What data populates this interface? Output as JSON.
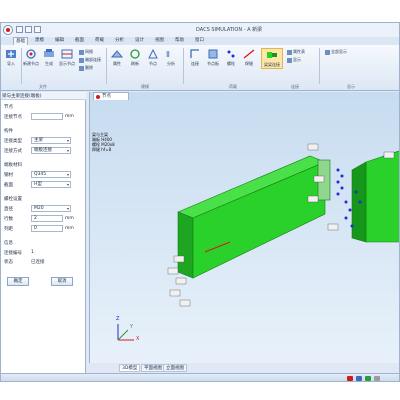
{
  "window": {
    "title": "DACS SIMULATION - A 新梁"
  },
  "tabs": [
    {
      "label": "基础",
      "active": true
    },
    {
      "label": "建模"
    },
    {
      "label": "编辑"
    },
    {
      "label": "截面"
    },
    {
      "label": "荷载"
    },
    {
      "label": "分析"
    },
    {
      "label": "设计"
    },
    {
      "label": "视图"
    },
    {
      "label": "帮助"
    },
    {
      "label": "窗口"
    }
  ],
  "ribbon": {
    "buttons": [
      {
        "label": "导入",
        "icon": "import-icon"
      },
      {
        "label": "新建节点",
        "icon": "node-icon"
      },
      {
        "label": "生成",
        "icon": "generate-icon"
      },
      {
        "label": "显示节点",
        "icon": "display-icon"
      },
      {
        "label": "网格",
        "icon": "grid-icon"
      },
      {
        "label": "端部连接",
        "icon": "end-connect-icon"
      },
      {
        "label": "删除",
        "icon": "delete-icon"
      },
      {
        "label": "属性",
        "icon": "properties-icon"
      },
      {
        "label": "刷新",
        "icon": "refresh-icon"
      },
      {
        "label": "节点",
        "icon": "node-icon-2"
      },
      {
        "label": "分析",
        "icon": "analyze-icon"
      },
      {
        "label": "连接",
        "icon": "connect-icon"
      },
      {
        "label": "节点板",
        "icon": "plate-icon"
      },
      {
        "label": "螺栓",
        "icon": "bolt-icon"
      },
      {
        "label": "焊缝",
        "icon": "weld-icon"
      },
      {
        "label": "梁梁连接",
        "icon": "beam-beam-icon"
      },
      {
        "label": "属性表",
        "icon": "table-icon"
      },
      {
        "label": "显示",
        "icon": "show-icon"
      },
      {
        "label": "全部显示",
        "icon": "show-all-icon"
      }
    ],
    "groups": [
      {
        "label": "文件"
      },
      {
        "label": "建模"
      },
      {
        "label": "荷载"
      },
      {
        "label": "连接"
      },
      {
        "label": "显示"
      }
    ]
  },
  "panel": {
    "title": "梁与主梁连接(端板)",
    "section_main": "节点",
    "label_node": "连接节点",
    "node_value": "",
    "node_unit": "mm",
    "section_type": "构件",
    "label_type1": "连接类型",
    "type1_value": "主梁",
    "label_type2": "连接方式",
    "type2_value": "端板连接",
    "section_material": "端板材料",
    "label_mat1": "钢材",
    "mat1_value": "Q345",
    "label_mat2": "截面",
    "mat2_value": "H型",
    "section_bolt": "螺栓设置",
    "label_bolt1": "直径",
    "bolt1_value": "M20",
    "label_bolt2": "行数",
    "bolt2_value": "2",
    "label_bolt3": "列距",
    "bolt3_value": "0",
    "bolt_unit": "mm",
    "section_info": "信息",
    "info_label1": "连接编号",
    "info_value1": "1",
    "info_label2": "状态",
    "info_value2": "已连接",
    "ok_label": "确定",
    "cancel_label": "取消"
  },
  "viewport": {
    "doc_tab": "节点",
    "annotation_lines": [
      "梁与主梁",
      "端板 H400",
      "螺栓 M20x8",
      "焊缝 hf=8"
    ],
    "axis_x": "X",
    "axis_y": "Y",
    "axis_z": "Z"
  },
  "view_tabs": [
    {
      "label": "3D模型",
      "active": true
    },
    {
      "label": "平面视图"
    },
    {
      "label": "立面视图"
    }
  ],
  "colors": {
    "beam_green": "#2bd12b",
    "beam_dark": "#16961a",
    "bolt_blue": "#1f2bd6",
    "accent_red": "#d11c1c"
  }
}
